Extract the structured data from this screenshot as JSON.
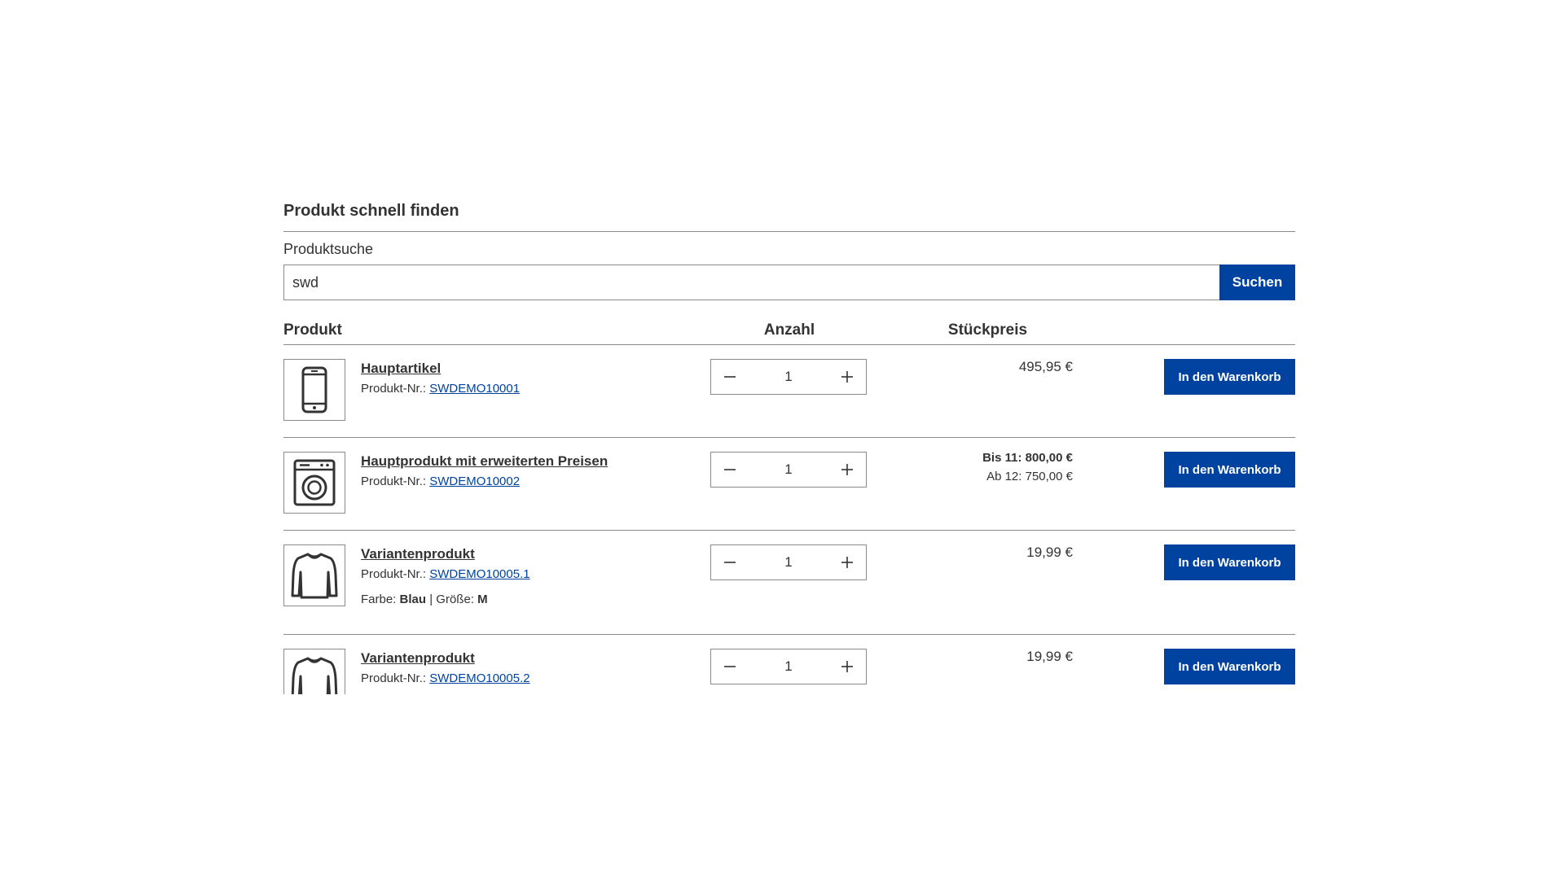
{
  "panel": {
    "title": "Produkt schnell finden",
    "search_label": "Produktsuche",
    "search_value": "swd",
    "search_button": "Suchen"
  },
  "table": {
    "headers": {
      "product": "Produkt",
      "quantity": "Anzahl",
      "unit_price": "Stückpreis"
    },
    "product_no_label": "Produkt-Nr.:",
    "cart_button": "In den Warenkorb",
    "rows": [
      {
        "name": "Hauptartikel",
        "number": "SWDEMO10001",
        "qty": "1",
        "price": "495,95 €",
        "icon": "smartphone-icon"
      },
      {
        "name": "Hauptprodukt mit erweiterten Preisen",
        "number": "SWDEMO10002",
        "qty": "1",
        "tier1": "Bis 11: 800,00 €",
        "tier2": "Ab 12: 750,00 €",
        "icon": "washing-machine-icon"
      },
      {
        "name": "Variantenprodukt",
        "number": "SWDEMO10005.1",
        "qty": "1",
        "price": "19,99 €",
        "icon": "sweater-icon",
        "variant": {
          "color_label": "Farbe:",
          "color": "Blau",
          "sep": "|",
          "size_label": "Größe:",
          "size": "M"
        }
      },
      {
        "name": "Variantenprodukt",
        "number": "SWDEMO10005.2",
        "qty": "1",
        "price": "19,99 €",
        "icon": "sweater-icon"
      }
    ]
  },
  "colors": {
    "primary": "#0042a0",
    "border": "#8a8a8a",
    "text": "#333333"
  }
}
